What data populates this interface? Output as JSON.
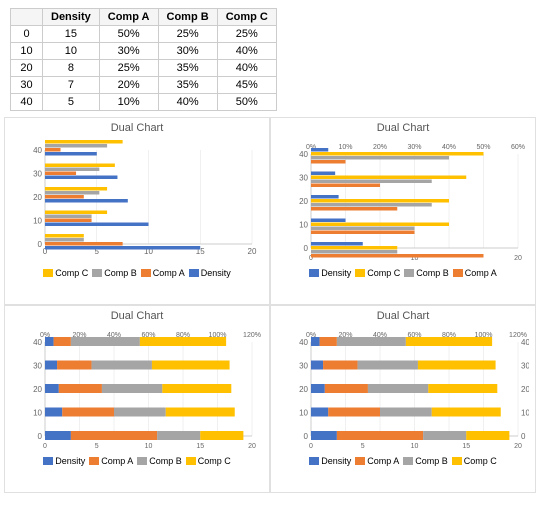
{
  "table": {
    "headers": [
      "",
      "Density",
      "Comp A",
      "Comp B",
      "Comp C"
    ],
    "rows": [
      [
        "0",
        "15",
        "50%",
        "25%",
        "25%"
      ],
      [
        "10",
        "10",
        "30%",
        "30%",
        "40%"
      ],
      [
        "20",
        "8",
        "25%",
        "35%",
        "40%"
      ],
      [
        "30",
        "7",
        "20%",
        "35%",
        "45%"
      ],
      [
        "40",
        "5",
        "10%",
        "40%",
        "50%"
      ]
    ]
  },
  "charts": {
    "title": "Dual Chart",
    "colors": {
      "density": "#4472C4",
      "compA": "#ED7D31",
      "compB": "#A5A5A5",
      "compC": "#FFC000"
    },
    "data": [
      {
        "y": 0,
        "density": 15,
        "compA": 50,
        "compB": 25,
        "compC": 25
      },
      {
        "y": 10,
        "density": 10,
        "compA": 30,
        "compB": 30,
        "compC": 40
      },
      {
        "y": 20,
        "density": 8,
        "compA": 25,
        "compB": 35,
        "compC": 40
      },
      {
        "y": 30,
        "density": 7,
        "compA": 20,
        "compB": 35,
        "compC": 45
      },
      {
        "y": 40,
        "density": 5,
        "compA": 10,
        "compB": 40,
        "compC": 50
      }
    ],
    "legends": {
      "tl": [
        "Comp C",
        "Comp B",
        "Comp A",
        "Density"
      ],
      "tr": [
        "Density",
        "Comp C",
        "Comp B",
        "Comp A"
      ],
      "bl": [
        "Density",
        "Comp A",
        "Comp B",
        "Comp C"
      ],
      "br": [
        "Density",
        "Comp A",
        "Comp B",
        "Comp C"
      ]
    }
  }
}
